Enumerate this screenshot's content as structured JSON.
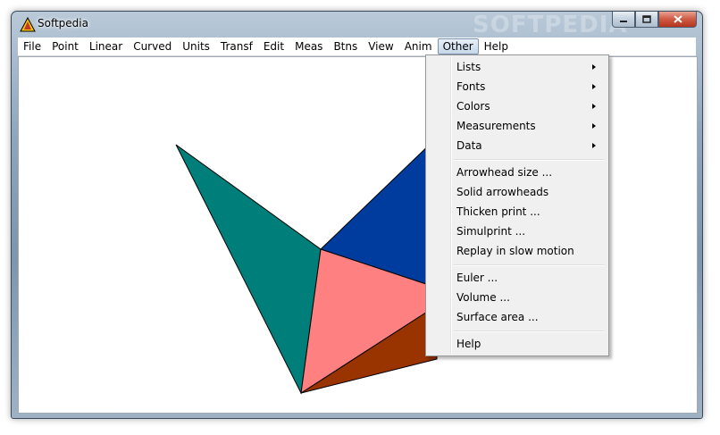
{
  "window": {
    "title": "Softpedia",
    "watermark": "SOFTPEDIA"
  },
  "colors": {
    "teal_face": "#007f7a",
    "blue_face": "#003c9e",
    "pink_face": "#ff8080",
    "brown_face": "#993300"
  },
  "menubar": {
    "items": [
      "File",
      "Point",
      "Linear",
      "Curved",
      "Units",
      "Transf",
      "Edit",
      "Meas",
      "Btns",
      "View",
      "Anim",
      "Other",
      "Help"
    ],
    "active": "Other"
  },
  "other_menu": {
    "submenus": [
      "Lists",
      "Fonts",
      "Colors",
      "Measurements",
      "Data"
    ],
    "actions": [
      "Arrowhead size ...",
      "Solid arrowheads",
      "Thicken print ...",
      "Simulprint ...",
      "Replay in slow motion"
    ],
    "solids": [
      "Euler ...",
      "Volume ...",
      "Surface area ..."
    ],
    "help": "Help"
  }
}
